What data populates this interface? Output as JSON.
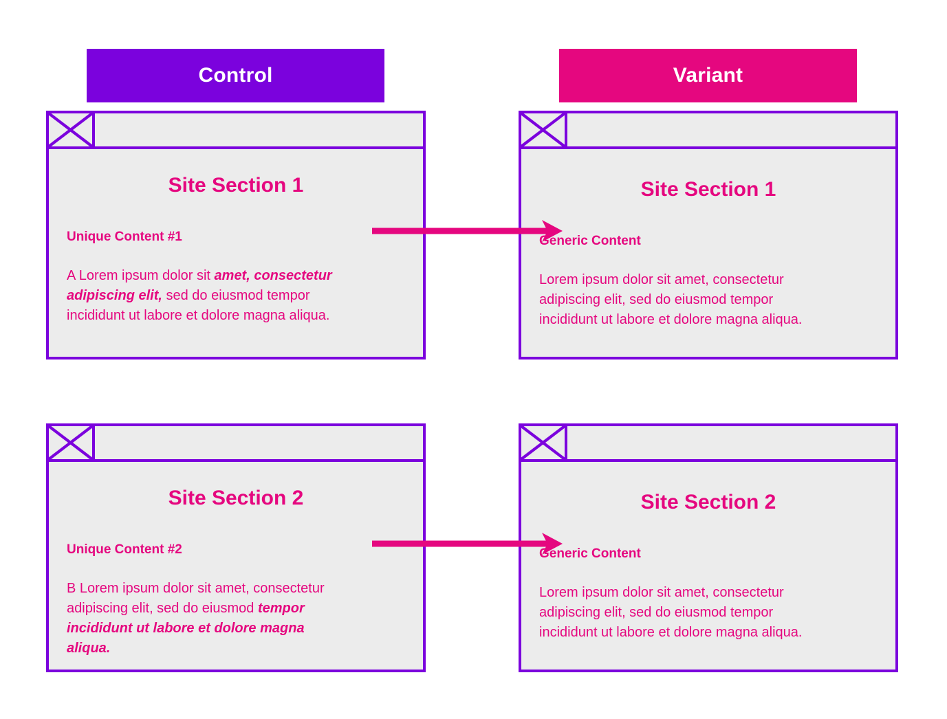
{
  "columns": {
    "control": {
      "label": "Control",
      "color": "#7B02DD"
    },
    "variant": {
      "label": "Variant",
      "color": "#E5077F"
    }
  },
  "theme": {
    "purple": "#7B02DD",
    "pink": "#E5077F",
    "window_fill": "#ececec",
    "page_background": "#ffffff"
  },
  "icons": {
    "logo_placeholder": "crossed-box-icon"
  },
  "rows": [
    {
      "control": {
        "section_title": "Site Section 1",
        "content_label": "Unique Content #1",
        "body": {
          "segments": [
            {
              "text": "A Lorem ipsum dolor sit ",
              "emphasis": false
            },
            {
              "text": "amet, consectetur adipiscing elit,",
              "emphasis": true
            },
            {
              "text": " sed do eiusmod tempor incididunt ut labore et dolore magna aliqua.",
              "emphasis": false
            }
          ]
        }
      },
      "variant": {
        "section_title": "Site Section 1",
        "content_label": "Generic Content",
        "body": {
          "segments": [
            {
              "text": "Lorem ipsum dolor sit amet, consectetur adipiscing elit, sed do eiusmod tempor incididunt ut labore et dolore magna aliqua.",
              "emphasis": false
            }
          ]
        }
      },
      "arrow": {
        "name": "control-to-variant-arrow-1",
        "color": "#E5077F"
      }
    },
    {
      "control": {
        "section_title": "Site Section 2",
        "content_label": "Unique Content #2",
        "body": {
          "segments": [
            {
              "text": "B Lorem ipsum dolor sit amet, consectetur adipiscing elit, sed do eiusmod ",
              "emphasis": false
            },
            {
              "text": "tempor incididunt ut labore et dolore magna aliqua.",
              "emphasis": true
            }
          ]
        }
      },
      "variant": {
        "section_title": "Site Section 2",
        "content_label": "Generic Content",
        "body": {
          "segments": [
            {
              "text": "Lorem ipsum dolor sit amet, consectetur adipiscing elit, sed do eiusmod tempor incididunt ut labore et dolore magna aliqua.",
              "emphasis": false
            }
          ]
        }
      },
      "arrow": {
        "name": "control-to-variant-arrow-2",
        "color": "#E5077F"
      }
    }
  ]
}
